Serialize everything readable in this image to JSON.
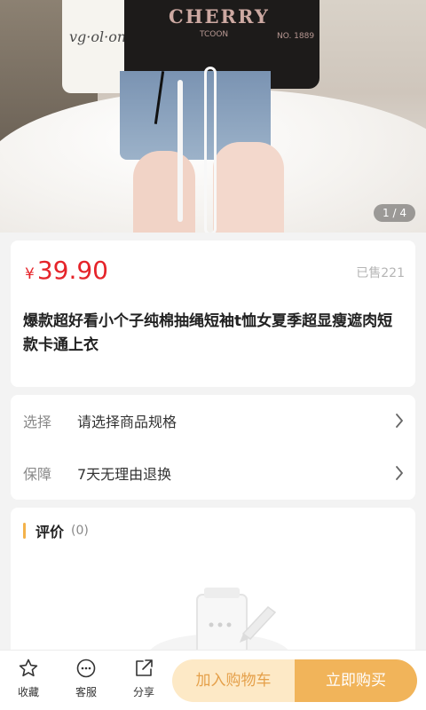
{
  "hero": {
    "counter": "1 / 4",
    "shirt_text": "CHERRY",
    "shirt_sub": "TCOON",
    "shirt_no": "NO. 1889",
    "bag_text": "vg·ol·on"
  },
  "product": {
    "currency": "¥",
    "price": "39.90",
    "sold": "已售221",
    "title": "爆款超好看小个子纯棉抽绳短袖t恤女夏季超显瘦遮肉短款卡通上衣"
  },
  "specs": [
    {
      "label": "选择",
      "value": "请选择商品规格"
    },
    {
      "label": "保障",
      "value": "7天无理由退换"
    }
  ],
  "review": {
    "title": "评价",
    "count": "(0)"
  },
  "bottom": {
    "favorite": "收藏",
    "service": "客服",
    "share": "分享",
    "add_cart": "加入购物车",
    "buy_now": "立即购买"
  },
  "colors": {
    "price": "#e5242a",
    "accent": "#f1b45a",
    "cart_bg": "#fde9c6"
  },
  "icons": [
    "star-icon",
    "chat-icon",
    "share-icon",
    "chevron-right-icon",
    "empty-review-icon"
  ]
}
